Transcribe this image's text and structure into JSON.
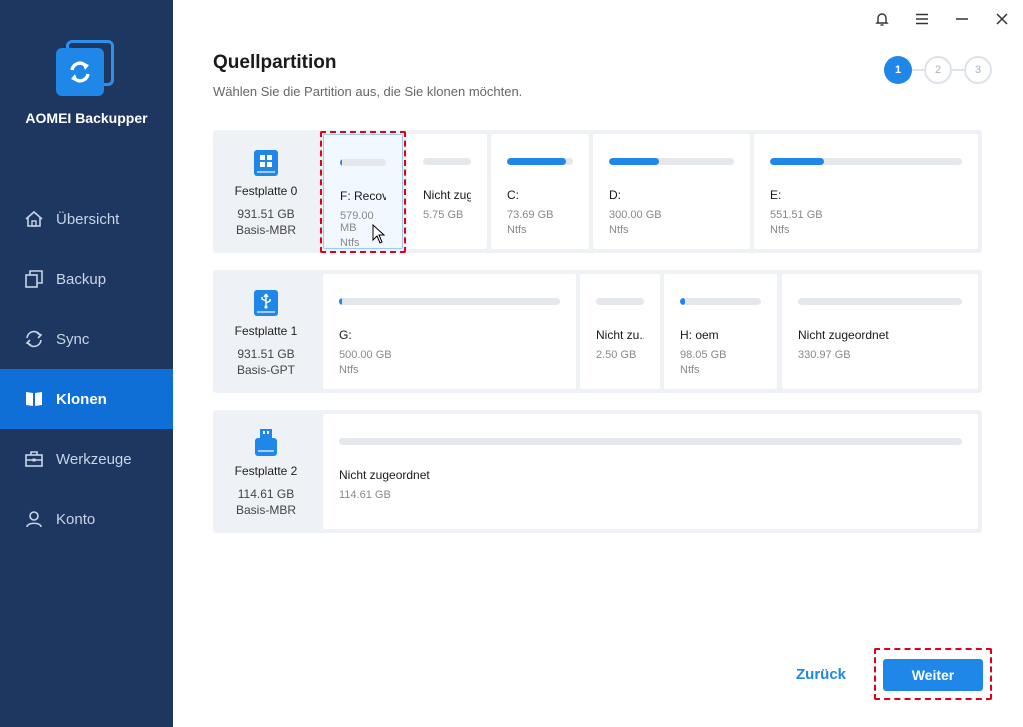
{
  "app": {
    "name": "AOMEI Backupper"
  },
  "nav": [
    {
      "label": "Übersicht",
      "icon": "home-icon",
      "active": false
    },
    {
      "label": "Backup",
      "icon": "backup-icon",
      "active": false
    },
    {
      "label": "Sync",
      "icon": "sync-icon",
      "active": false
    },
    {
      "label": "Klonen",
      "icon": "clone-icon",
      "active": true
    },
    {
      "label": "Werkzeuge",
      "icon": "toolbox-icon",
      "active": false
    },
    {
      "label": "Konto",
      "icon": "user-icon",
      "active": false
    }
  ],
  "window": {
    "icons": [
      "bell-icon",
      "menu-icon",
      "minimize-icon",
      "close-icon"
    ]
  },
  "header": {
    "title": "Quellpartition",
    "subtitle": "Wählen Sie die Partition aus, die Sie klonen möchten.",
    "steps": [
      "1",
      "2",
      "3"
    ],
    "current_step": 1
  },
  "disks": [
    {
      "name": "Festplatte 0",
      "size": "931.51 GB",
      "type": "Basis-MBR",
      "icon": "windows-disk-icon",
      "partitions": [
        {
          "name": "F: Recovery",
          "size": "579.00 MB",
          "fs": "Ntfs",
          "used": 0.05,
          "selected": true
        },
        {
          "name": "Nicht zug...",
          "size": "5.75 GB",
          "fs": "",
          "used": 0
        },
        {
          "name": "C:",
          "size": "73.69 GB",
          "fs": "Ntfs",
          "used": 0.9
        },
        {
          "name": "D:",
          "size": "300.00 GB",
          "fs": "Ntfs",
          "used": 0.4
        },
        {
          "name": "E:",
          "size": "551.51 GB",
          "fs": "Ntfs",
          "used": 0.28
        }
      ]
    },
    {
      "name": "Festplatte 1",
      "size": "931.51 GB",
      "type": "Basis-GPT",
      "icon": "usb-disk-icon",
      "partitions": [
        {
          "name": "G:",
          "size": "500.00 GB",
          "fs": "Ntfs",
          "used": 0.01
        },
        {
          "name": "Nicht zu...",
          "size": "2.50 GB",
          "fs": "",
          "used": 0
        },
        {
          "name": "H: oem",
          "size": "98.05 GB",
          "fs": "Ntfs",
          "used": 0.06
        },
        {
          "name": "Nicht zugeordnet",
          "size": "330.97 GB",
          "fs": "",
          "used": 0
        }
      ]
    },
    {
      "name": "Festplatte 2",
      "size": "114.61 GB",
      "type": "Basis-MBR",
      "icon": "usb-drive-icon",
      "partitions": [
        {
          "name": "Nicht zugeordnet",
          "size": "114.61 GB",
          "fs": "",
          "used": 0
        }
      ]
    }
  ],
  "buttons": {
    "back": "Zurück",
    "next": "Weiter"
  },
  "colors": {
    "sidebar": "#1e3760",
    "accent": "#1f87e8",
    "highlight": "#e0001b"
  }
}
